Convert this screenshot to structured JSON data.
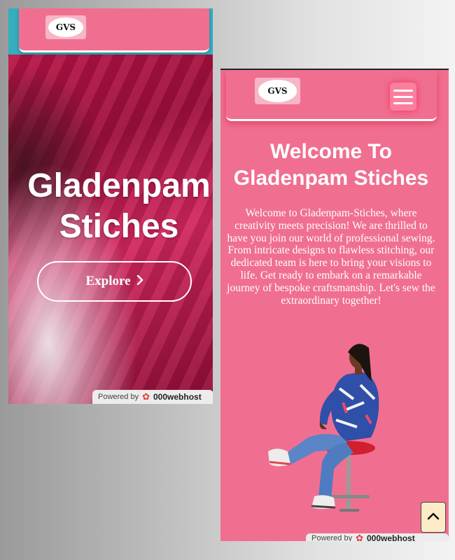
{
  "left_screen": {
    "logo_text": "GVS",
    "hero_title_line1": "Gladenpam",
    "hero_title_line2": "Stiches",
    "explore_label": "Explore",
    "powered_by_label": "Powered by",
    "powered_by_brand": "000webhost"
  },
  "right_screen": {
    "logo_text": "GVS",
    "menu_icon": "hamburger-menu-icon",
    "title_line1": "Welcome To",
    "title_line2": "Gladenpam Stiches",
    "intro_paragraph": "Welcome to Gladenpam-Stiches, where creativity meets precision! We are thrilled to have you join our world of professional sewing. From intricate designs to flawless stitching, our dedicated team is here to bring your visions to life. Get ready to embark on a remarkable journey of bespoke craftsmanship. Let's sew the extraordinary together!",
    "powered_by_label": "Powered by",
    "powered_by_brand": "000webhost"
  },
  "scroll_top_icon": "chevron-up-icon",
  "colors": {
    "brand_pink": "#f06f90",
    "hero_crimson": "#c2164a",
    "top_band_teal": "#35aebf",
    "text_white": "#ffffff",
    "scroll_button_bg": "#fdebc8"
  }
}
